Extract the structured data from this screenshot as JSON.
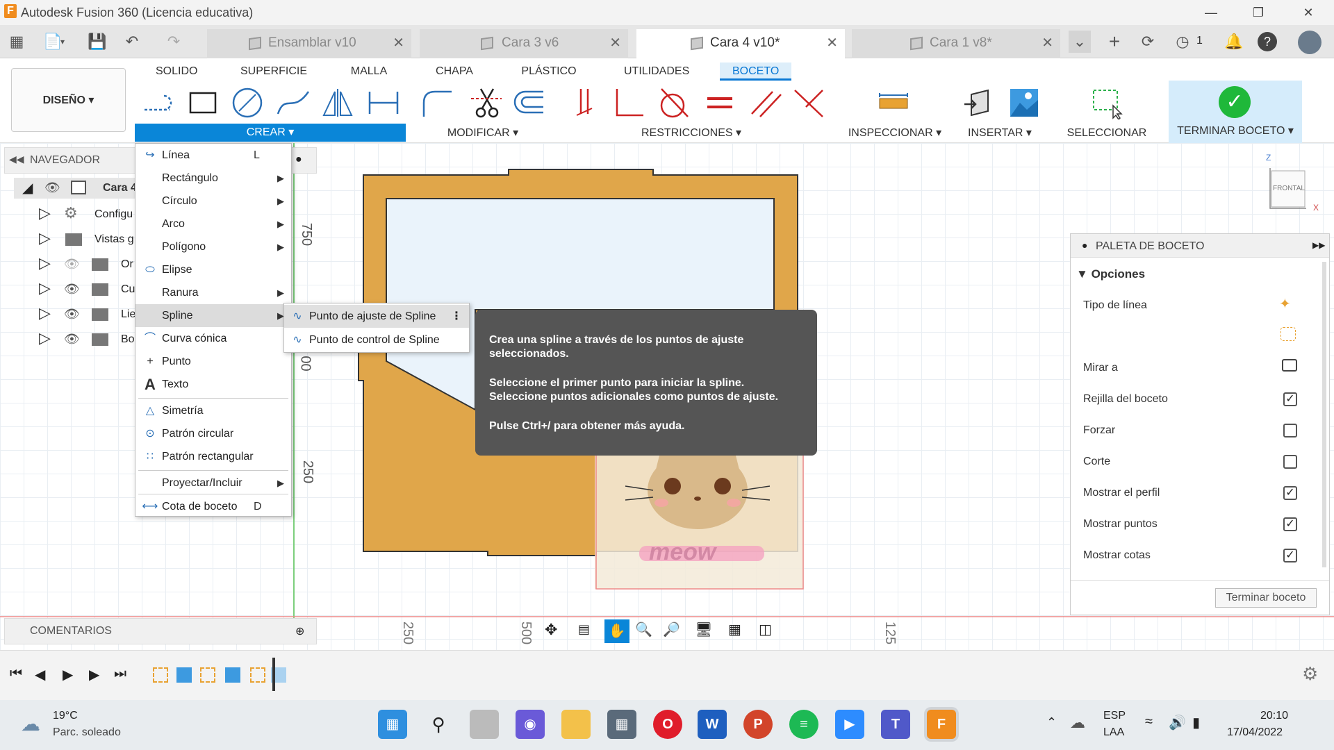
{
  "window": {
    "title": "Autodesk Fusion 360 (Licencia educativa)",
    "logo": "F"
  },
  "tabs": [
    {
      "label": "Ensamblar v10",
      "active": false
    },
    {
      "label": "Cara 3 v6",
      "active": false
    },
    {
      "label": "Cara 4 v10*",
      "active": true
    },
    {
      "label": "Cara 1 v8*",
      "active": false
    }
  ],
  "tabbar": {
    "badge_count": "1"
  },
  "ribbon": {
    "tabs": [
      "SOLIDO",
      "SUPERFICIE",
      "MALLA",
      "CHAPA",
      "PLÁSTICO",
      "UTILIDADES",
      "BOCETO"
    ],
    "active_tab": "BOCETO",
    "workspace": "DISEÑO ▾",
    "groups": {
      "crear": "CREAR ▾",
      "modificar": "MODIFICAR ▾",
      "restricciones": "RESTRICCIONES ▾",
      "inspeccionar": "INSPECCIONAR ▾",
      "insertar": "INSERTAR ▾",
      "seleccionar": "SELECCIONAR ▾",
      "terminar": "TERMINAR BOCETO ▾"
    }
  },
  "navigator": {
    "title": "NAVEGADOR",
    "root": "Cara 4",
    "items": [
      "Configu",
      "Vistas g",
      "Or",
      "Cu",
      "Lie",
      "Bo"
    ]
  },
  "crear_menu": {
    "items": [
      {
        "label": "Línea",
        "shortcut": "L"
      },
      {
        "label": "Rectángulo"
      },
      {
        "label": "Círculo"
      },
      {
        "label": "Arco"
      },
      {
        "label": "Polígono"
      },
      {
        "label": "Elipse"
      },
      {
        "label": "Ranura"
      },
      {
        "label": "Spline"
      },
      {
        "label": "Curva cónica"
      },
      {
        "label": "Punto"
      },
      {
        "label": "Texto"
      },
      {
        "label": "Simetría"
      },
      {
        "label": "Patrón circular"
      },
      {
        "label": "Patrón rectangular"
      },
      {
        "label": "Proyectar/Incluir"
      },
      {
        "label": "Cota de boceto",
        "shortcut": "D"
      }
    ]
  },
  "spline_submenu": [
    "Punto de ajuste de Spline",
    "Punto de control de Spline"
  ],
  "tooltip": {
    "line1": "Crea una spline a través de los puntos de ajuste seleccionados.",
    "line2": "Seleccione el primer punto para iniciar la spline. Seleccione puntos adicionales como puntos de ajuste.",
    "line3": "Pulse Ctrl+/ para obtener más ayuda."
  },
  "canvas": {
    "dim_labels": [
      "750",
      "00",
      "250"
    ],
    "bottom_ticks": [
      "250",
      "500",
      "125"
    ],
    "viewcube": {
      "face": "FRONTAL",
      "axis_z": "Z",
      "axis_x": "X"
    },
    "watermark": "meow"
  },
  "palette": {
    "title": "PALETA DE BOCETO",
    "section": "Opciones",
    "rows": [
      {
        "label": "Tipo de línea"
      },
      {
        "label": "Mirar a"
      },
      {
        "label": "Rejilla del boceto",
        "checked": true
      },
      {
        "label": "Forzar",
        "checked": false
      },
      {
        "label": "Corte",
        "checked": false
      },
      {
        "label": "Mostrar el perfil",
        "checked": true
      },
      {
        "label": "Mostrar puntos",
        "checked": true
      },
      {
        "label": "Mostrar cotas",
        "checked": true
      }
    ],
    "finish_button": "Terminar boceto"
  },
  "comments": {
    "title": "COMENTARIOS"
  },
  "taskbar": {
    "weather_temp": "19°C",
    "weather_desc": "Parc. soleado",
    "lang": "ESP",
    "layout": "LAA",
    "time": "20:10",
    "date": "17/04/2022"
  },
  "colors": {
    "accent": "#0a86d8",
    "wood": "#e0a64a",
    "finish_green": "#1fb83a"
  }
}
